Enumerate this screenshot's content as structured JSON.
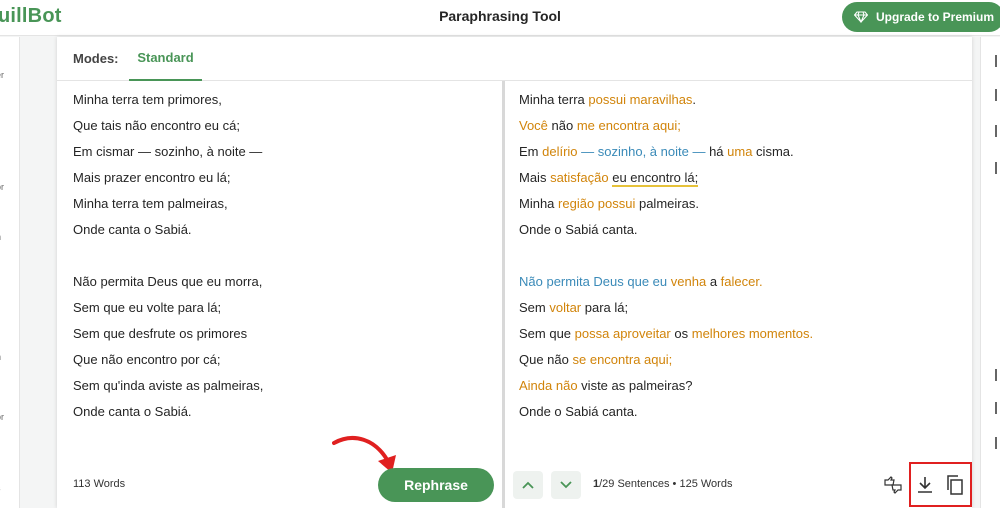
{
  "app": {
    "logo_text": "uillBot",
    "title": "Paraphrasing Tool",
    "upgrade_label": "Upgrade to Premium"
  },
  "left_sidebar": {
    "items": [
      "er",
      "r",
      "or",
      "n",
      "n",
      "or",
      "s"
    ]
  },
  "modes": {
    "label": "Modes:",
    "active_mode": "Standard"
  },
  "input": {
    "lines": [
      "Minha terra tem primores,",
      "Que tais não encontro eu cá;",
      "Em cismar — sozinho, à noite —",
      "Mais prazer encontro eu lá;",
      "Minha terra tem palmeiras,",
      "Onde canta o Sabiá.",
      "",
      "Não permita Deus que eu morra,",
      "Sem que eu volte para lá;",
      "Sem que desfrute os primores",
      "Que não encontro por cá;",
      "Sem qu'inda aviste as palmeiras,",
      "Onde canta o Sabiá."
    ],
    "word_count": "113 Words",
    "rephrase_label": "Rephrase"
  },
  "output": {
    "lines": [
      [
        {
          "t": "Minha terra ",
          "c": ""
        },
        {
          "t": "possui maravilhas",
          "c": "syn"
        },
        {
          "t": ".",
          "c": ""
        }
      ],
      [
        {
          "t": "Você",
          "c": "syn"
        },
        {
          "t": " não ",
          "c": ""
        },
        {
          "t": "me encontra aqui;",
          "c": "syn"
        }
      ],
      [
        {
          "t": "Em ",
          "c": ""
        },
        {
          "t": "delírio",
          "c": "syn"
        },
        {
          "t": " — sozinho, à noite —",
          "c": "struct"
        },
        {
          "t": " há ",
          "c": ""
        },
        {
          "t": "uma",
          "c": "syn"
        },
        {
          "t": " cisma.",
          "c": ""
        }
      ],
      [
        {
          "t": "Mais ",
          "c": ""
        },
        {
          "t": "satisfação",
          "c": "syn"
        },
        {
          "t": " ",
          "c": ""
        },
        {
          "t": "eu encontro lá;",
          "c": "under"
        }
      ],
      [
        {
          "t": "Minha ",
          "c": ""
        },
        {
          "t": "região possui",
          "c": "syn"
        },
        {
          "t": " palmeiras.",
          "c": ""
        }
      ],
      [
        {
          "t": "Onde o Sabiá canta.",
          "c": ""
        }
      ],
      [],
      [
        {
          "t": "Não permita Deus que eu",
          "c": "struct"
        },
        {
          "t": " ",
          "c": ""
        },
        {
          "t": "venha",
          "c": "syn"
        },
        {
          "t": " a ",
          "c": ""
        },
        {
          "t": "falecer.",
          "c": "syn"
        }
      ],
      [
        {
          "t": "Sem ",
          "c": ""
        },
        {
          "t": "voltar",
          "c": "syn"
        },
        {
          "t": " para lá;",
          "c": ""
        }
      ],
      [
        {
          "t": "Sem que ",
          "c": ""
        },
        {
          "t": "possa aproveitar",
          "c": "syn"
        },
        {
          "t": " os ",
          "c": ""
        },
        {
          "t": "melhores momentos.",
          "c": "syn"
        }
      ],
      [
        {
          "t": "Que não ",
          "c": ""
        },
        {
          "t": "se encontra aqui;",
          "c": "syn"
        }
      ],
      [
        {
          "t": "Ainda não",
          "c": "syn"
        },
        {
          "t": " viste as palmeiras?",
          "c": ""
        }
      ],
      [
        {
          "t": "Onde o Sabiá canta.",
          "c": ""
        }
      ]
    ],
    "sentence_current": "1",
    "sentence_total": "/29 Sentences",
    "bullet": "•",
    "word_count": "125 Words"
  },
  "icons": {
    "upgrade": "diamond-icon",
    "nav_up": "chevron-up-icon",
    "nav_down": "chevron-down-icon",
    "feedback": "thumbs-up-down-icon",
    "download": "download-icon",
    "copy": "copy-icon"
  },
  "colors": {
    "brand": "#499557",
    "synonym": "#d1840a",
    "structure": "#3a8ab8",
    "highlight_box": "#e02020"
  }
}
